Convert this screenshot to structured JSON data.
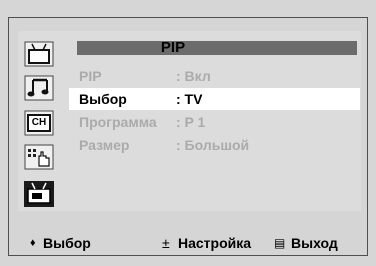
{
  "menu": {
    "title": "PIP",
    "rows": [
      {
        "label": "PIP",
        "value": ": Вкл",
        "state": "dim"
      },
      {
        "label": "Выбор",
        "value": ": TV",
        "state": "selected"
      },
      {
        "label": "Программа",
        "value": ": P 1",
        "state": "dim"
      },
      {
        "label": "Размер",
        "value": ": Большой",
        "state": "dim"
      }
    ]
  },
  "sidebar": {
    "icons": [
      "tv-picture-icon",
      "sound-notes-icon",
      "channel-ch-icon",
      "setup-hand-icon",
      "pip-tv-icon"
    ],
    "ch_label": "CH"
  },
  "footer": {
    "move_symbol": "♦",
    "move_label": "Выбор",
    "adjust_symbol": "±",
    "adjust_label": "Настройка",
    "exit_symbol": "▤",
    "exit_label": "Выход"
  },
  "colors": {
    "background": "#d6d6d6",
    "title_bar": "#6c6c6c",
    "selected_row": "#ffffff",
    "dim_text": "#ababab"
  }
}
